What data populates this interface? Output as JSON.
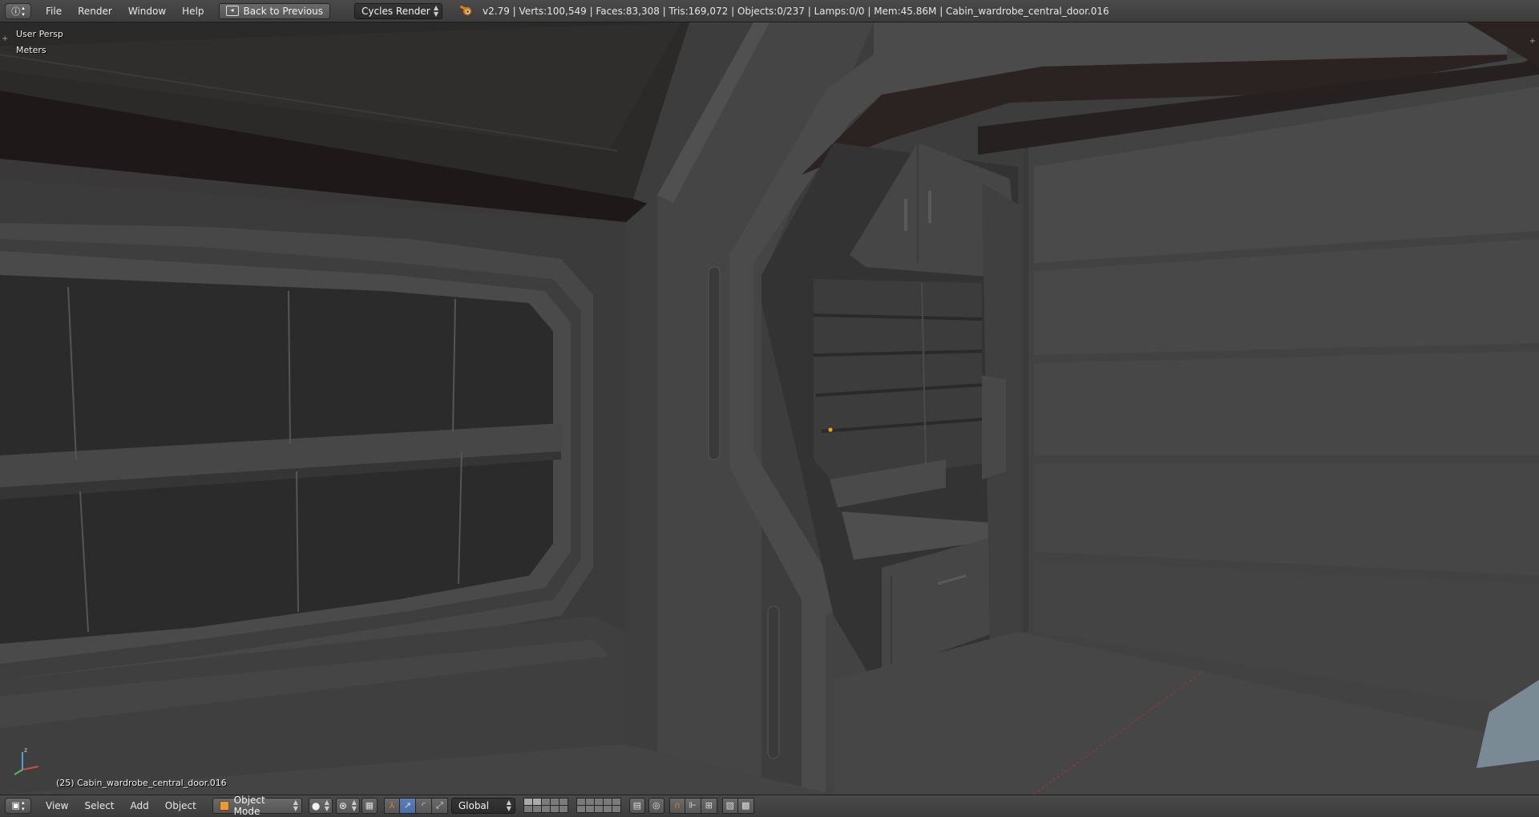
{
  "header": {
    "menus": [
      "File",
      "Render",
      "Window",
      "Help"
    ],
    "back_button": "Back to Previous",
    "render_engine": "Cycles Render",
    "stats": "v2.79 | Verts:100,549 | Faces:83,308 | Tris:169,072 | Objects:0/237 | Lamps:0/0 | Mem:45.86M | Cabin_wardrobe_central_door.016"
  },
  "viewport": {
    "view_name": "User Persp",
    "units": "Meters",
    "active_object": "(25) Cabin_wardrobe_central_door.016"
  },
  "footer": {
    "menus": [
      "View",
      "Select",
      "Add",
      "Object"
    ],
    "mode": "Object Mode",
    "orientation": "Global"
  },
  "icons": {
    "editor_type": "info-icon",
    "logo": "blender-logo-icon",
    "view3d_editor_type": "view3d-icon",
    "pivot": "pivot-point-icon",
    "manipulator": "manipulator-icon",
    "translate": "translate-icon",
    "rotate": "rotate-icon",
    "scale": "scale-icon",
    "render_preview": "render-icon",
    "snap": "magnet-icon"
  },
  "colors": {
    "mode_accent": "#e69a3a",
    "active_toggle": "#5b7fb6",
    "origin_dot": "#e8a01c"
  }
}
